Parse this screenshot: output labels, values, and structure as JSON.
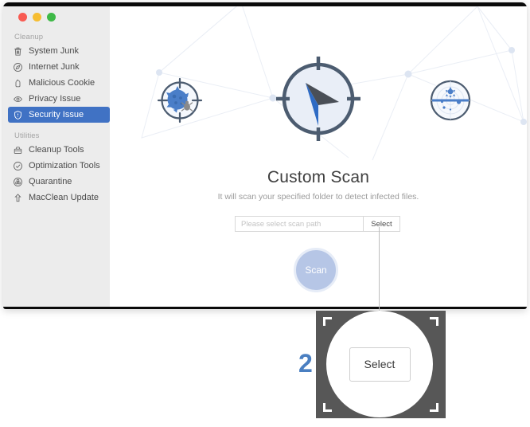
{
  "window": {
    "traffic_lights": [
      {
        "name": "close",
        "color": "#f85b52"
      },
      {
        "name": "minimize",
        "color": "#f6bd31"
      },
      {
        "name": "maximize",
        "color": "#3eb947"
      }
    ]
  },
  "sidebar": {
    "groups": [
      {
        "title": "Cleanup",
        "items": [
          {
            "label": "System Junk",
            "icon": "trash-icon",
            "active": false
          },
          {
            "label": "Internet Junk",
            "icon": "compass-icon",
            "active": false
          },
          {
            "label": "Malicious Cookie",
            "icon": "cookie-icon",
            "active": false
          },
          {
            "label": "Privacy Issue",
            "icon": "eye-icon",
            "active": false
          },
          {
            "label": "Security Issue",
            "icon": "shield-icon",
            "active": true
          }
        ]
      },
      {
        "title": "Utilities",
        "items": [
          {
            "label": "Cleanup Tools",
            "icon": "toolbox-icon",
            "active": false
          },
          {
            "label": "Optimization Tools",
            "icon": "check-icon",
            "active": false
          },
          {
            "label": "Quarantine",
            "icon": "biohazard-icon",
            "active": false
          },
          {
            "label": "MacClean Update",
            "icon": "arrow-up-icon",
            "active": false
          }
        ]
      }
    ],
    "active_color": "#4072c4",
    "background": "#ececec"
  },
  "main": {
    "illustration": {
      "left_icon": "virus-target-icon",
      "center_icon": "compass-target-icon",
      "right_icon": "radar-scan-icon"
    },
    "title": "Custom Scan",
    "subtitle": "It will scan your specified folder to detect infected files.",
    "path_input": {
      "placeholder": "Please select scan path",
      "value": ""
    },
    "select_label": "Select",
    "scan_label": "Scan",
    "scan_button_color": "#b6c6e6"
  },
  "callout": {
    "step_number": "2",
    "step_number_color": "#4a7fc1",
    "magnified_label": "Select",
    "background": "#575757"
  }
}
